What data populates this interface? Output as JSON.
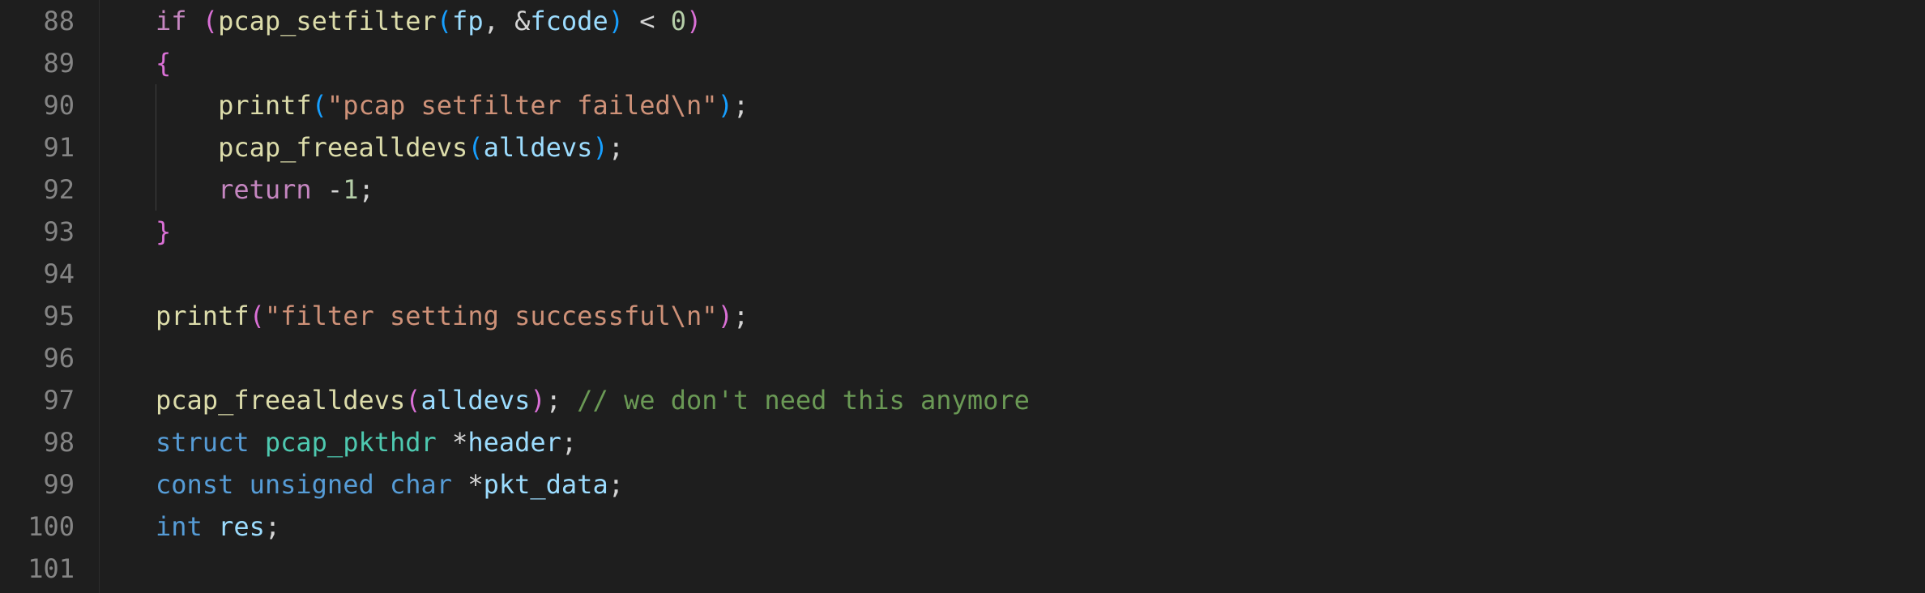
{
  "editor": {
    "lines": [
      {
        "num": "88",
        "tokens": [
          {
            "t": "if",
            "c": "kw"
          },
          {
            "t": " ",
            "c": "p"
          },
          {
            "t": "(",
            "c": "b1"
          },
          {
            "t": "pcap_setfilter",
            "c": "fn"
          },
          {
            "t": "(",
            "c": "b2"
          },
          {
            "t": "fp",
            "c": "id"
          },
          {
            "t": ", &",
            "c": "p"
          },
          {
            "t": "fcode",
            "c": "id"
          },
          {
            "t": ")",
            "c": "b2"
          },
          {
            "t": " < ",
            "c": "p"
          },
          {
            "t": "0",
            "c": "n"
          },
          {
            "t": ")",
            "c": "b1"
          }
        ]
      },
      {
        "num": "89",
        "tokens": [
          {
            "t": "{",
            "c": "b1"
          }
        ]
      },
      {
        "num": "90",
        "tokens": [
          {
            "t": "    ",
            "c": "p"
          },
          {
            "t": "printf",
            "c": "fn"
          },
          {
            "t": "(",
            "c": "b2"
          },
          {
            "t": "\"pcap setfilter failed\\n\"",
            "c": "s"
          },
          {
            "t": ")",
            "c": "b2"
          },
          {
            "t": ";",
            "c": "p"
          }
        ]
      },
      {
        "num": "91",
        "tokens": [
          {
            "t": "    ",
            "c": "p"
          },
          {
            "t": "pcap_freealldevs",
            "c": "fn"
          },
          {
            "t": "(",
            "c": "b2"
          },
          {
            "t": "alldevs",
            "c": "id"
          },
          {
            "t": ")",
            "c": "b2"
          },
          {
            "t": ";",
            "c": "p"
          }
        ]
      },
      {
        "num": "92",
        "tokens": [
          {
            "t": "    ",
            "c": "p"
          },
          {
            "t": "return",
            "c": "kw"
          },
          {
            "t": " -",
            "c": "p"
          },
          {
            "t": "1",
            "c": "n"
          },
          {
            "t": ";",
            "c": "p"
          }
        ]
      },
      {
        "num": "93",
        "tokens": [
          {
            "t": "}",
            "c": "b1"
          }
        ]
      },
      {
        "num": "94",
        "tokens": []
      },
      {
        "num": "95",
        "tokens": [
          {
            "t": "printf",
            "c": "fn"
          },
          {
            "t": "(",
            "c": "b1"
          },
          {
            "t": "\"filter setting successful\\n\"",
            "c": "s"
          },
          {
            "t": ")",
            "c": "b1"
          },
          {
            "t": ";",
            "c": "p"
          }
        ]
      },
      {
        "num": "96",
        "tokens": []
      },
      {
        "num": "97",
        "tokens": [
          {
            "t": "pcap_freealldevs",
            "c": "fn"
          },
          {
            "t": "(",
            "c": "b1"
          },
          {
            "t": "alldevs",
            "c": "id"
          },
          {
            "t": ")",
            "c": "b1"
          },
          {
            "t": "; ",
            "c": "p"
          },
          {
            "t": "// we don't need this anymore",
            "c": "c"
          }
        ]
      },
      {
        "num": "98",
        "tokens": [
          {
            "t": "struct",
            "c": "st"
          },
          {
            "t": " ",
            "c": "p"
          },
          {
            "t": "pcap_pkthdr",
            "c": "ty"
          },
          {
            "t": " *",
            "c": "p"
          },
          {
            "t": "header",
            "c": "id"
          },
          {
            "t": ";",
            "c": "p"
          }
        ]
      },
      {
        "num": "99",
        "tokens": [
          {
            "t": "const",
            "c": "st"
          },
          {
            "t": " ",
            "c": "p"
          },
          {
            "t": "unsigned",
            "c": "st"
          },
          {
            "t": " ",
            "c": "p"
          },
          {
            "t": "char",
            "c": "st"
          },
          {
            "t": " *",
            "c": "p"
          },
          {
            "t": "pkt_data",
            "c": "id"
          },
          {
            "t": ";",
            "c": "p"
          }
        ]
      },
      {
        "num": "100",
        "tokens": [
          {
            "t": "int",
            "c": "st"
          },
          {
            "t": " ",
            "c": "p"
          },
          {
            "t": "res",
            "c": "id"
          },
          {
            "t": ";",
            "c": "p"
          }
        ]
      },
      {
        "num": "101",
        "tokens": []
      }
    ]
  }
}
